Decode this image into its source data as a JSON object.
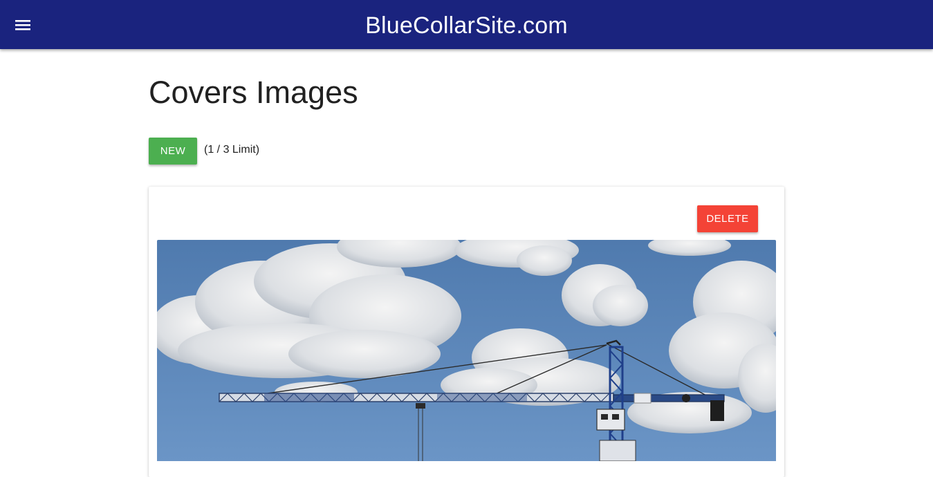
{
  "header": {
    "title": "BlueCollarSite.com",
    "menu_icon": "hamburger-menu-icon",
    "background": "#1a237e"
  },
  "page": {
    "title": "Covers Images"
  },
  "toolbar": {
    "new_label": "NEW",
    "new_color": "#4caf50",
    "limit_text": "(1 / 3 Limit)"
  },
  "cover_card": {
    "delete_label": "DELETE",
    "delete_color": "#f44336",
    "image_subject": "construction tower crane against cloudy blue sky"
  }
}
